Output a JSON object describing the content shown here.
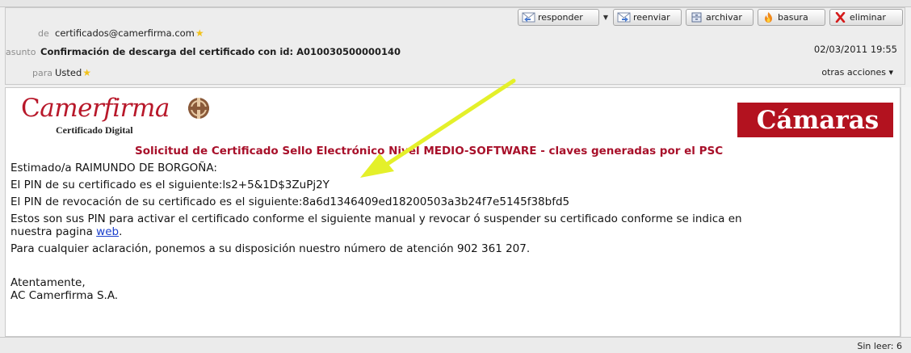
{
  "header": {
    "from_label": "de",
    "from_value": "certificados@camerfirma.com",
    "subject_label": "asunto",
    "subject_value": "Confirmación de descarga del certificado con id: A010030500000140",
    "to_label": "para",
    "to_value": "Usted",
    "star_icon": "star-icon",
    "date": "02/03/2011 19:55",
    "more_actions": "otras acciones ▾"
  },
  "toolbar": {
    "reply": "responder",
    "forward": "reenviar",
    "archive": "archivar",
    "junk": "basura",
    "delete": "eliminar"
  },
  "message": {
    "logo_left": "amerfirma",
    "logo_left_cap": "C",
    "logo_left_sub": "Certificado Digital",
    "logo_right": "ámaras",
    "logo_right_cap": "C",
    "title": "Solicitud de Certificado Sello Electrónico Nivel MEDIO-SOFTWARE - claves generadas por el PSC",
    "greeting": "Estimado/a RAIMUNDO DE BORGOÑA:",
    "pin_line": "El PIN de su certificado es el siguiente:ls2+5&1D$3ZuPj2Y",
    "revoke_line": "El PIN de revocación de su certificado es el siguiente:8a6d1346409ed18200503a3b24f7e5145f38bfd5",
    "info_line1": "Estos son sus PIN para activar el certificado conforme el siguiente manual y revocar ó suspender su certificado conforme se indica en",
    "info_line2_prefix": "nuestra pagina ",
    "info_link": "web",
    "info_line2_suffix": ".",
    "help_line": "Para cualquier aclaración, ponemos a su disposición nuestro número de atención 902 361 207.",
    "closing": "Atentamente,",
    "signature": "AC Camerfirma S.A."
  },
  "status": {
    "unread": "Sin leer: 6"
  },
  "colors": {
    "brand_red": "#b3121f",
    "title_red": "#a8102a",
    "arrow_yellow": "#e4f02a",
    "link_blue": "#1a3fcc"
  }
}
